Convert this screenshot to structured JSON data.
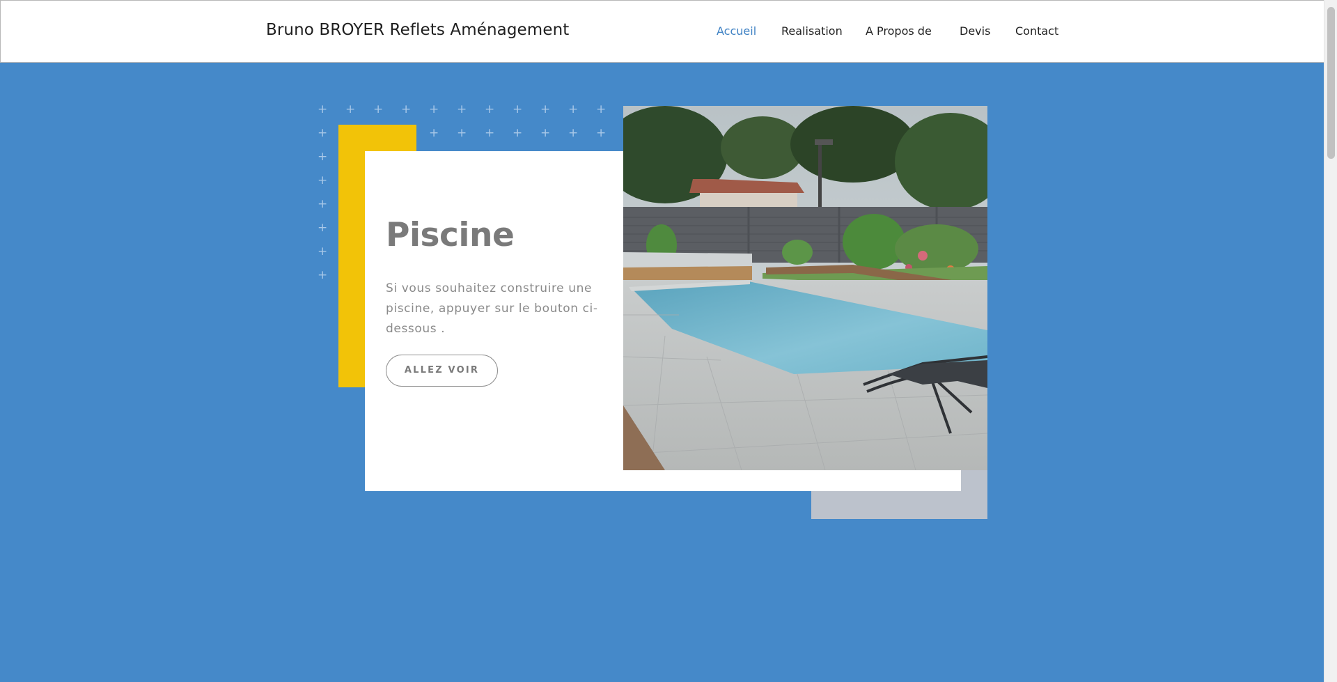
{
  "header": {
    "brand": "Bruno BROYER Reflets Aménagement",
    "nav": [
      {
        "label": "Accueil",
        "active": true
      },
      {
        "label": "Realisation",
        "active": false
      },
      {
        "label": "A Propos de",
        "active": false
      },
      {
        "label": "Devis",
        "active": false
      },
      {
        "label": "Contact",
        "active": false
      }
    ]
  },
  "hero": {
    "title": "Piscine",
    "text": "Si vous souhaitez construire une piscine, appuyer sur le bouton ci-dessous .",
    "button_label": "ALLEZ VOIR",
    "image_subject": "pool-photo"
  },
  "colors": {
    "background": "#4589c9",
    "accent_link": "#3f82c4",
    "yellow_block": "#f2c308",
    "gray_block": "#bcc2cc",
    "card": "#ffffff"
  },
  "icons": {
    "decor": "plus-icon"
  }
}
